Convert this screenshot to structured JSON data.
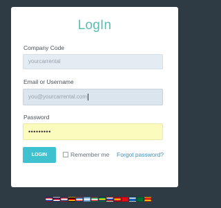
{
  "login": {
    "title": "LogIn",
    "company_code_label": "Company Code",
    "company_code_placeholder": "yourcarrental",
    "email_label": "Email or Username",
    "email_placeholder": "you@yourcarrental.com",
    "password_label": "Password",
    "password_value": "•••••••••",
    "login_button": "LOGIN",
    "remember_label": "Remember me",
    "forgot_link": "Forgot password?"
  },
  "languages": [
    {
      "icon": "flag-icon",
      "colors": [
        "#c8102e",
        "#ffffff",
        "#0033a0"
      ]
    },
    {
      "icon": "flag-icon",
      "colors": [
        "#012169",
        "#c8102e",
        "#ffffff"
      ]
    },
    {
      "icon": "flag-icon",
      "colors": [
        "#b22234",
        "#ffffff",
        "#3c3b6e"
      ]
    },
    {
      "icon": "flag-icon",
      "colors": [
        "#000000",
        "#dd0000",
        "#ffce00"
      ]
    },
    {
      "icon": "flag-icon",
      "colors": [
        "#0055a4",
        "#ffffff",
        "#ef4135"
      ]
    },
    {
      "icon": "flag-icon",
      "colors": [
        "#74acdf",
        "#ffffff",
        "#74acdf"
      ]
    },
    {
      "icon": "flag-icon",
      "colors": [
        "#009246",
        "#ffffff",
        "#ce2b37"
      ]
    },
    {
      "icon": "flag-icon",
      "colors": [
        "#009c3b",
        "#ffdf00",
        "#002776"
      ]
    },
    {
      "icon": "flag-icon",
      "colors": [
        "#ffffff",
        "#0039a6",
        "#d52b1e"
      ]
    },
    {
      "icon": "flag-icon",
      "colors": [
        "#c60b1e",
        "#ffc400",
        "#c60b1e"
      ]
    },
    {
      "icon": "flag-icon",
      "colors": [
        "#e30a17",
        "#e30a17",
        "#e30a17"
      ]
    },
    {
      "icon": "flag-icon",
      "colors": [
        "#ffffff",
        "#0d5eaf",
        "#0d5eaf"
      ]
    },
    {
      "icon": "flag-icon",
      "colors": [
        "#006c35",
        "#006c35",
        "#006c35"
      ]
    },
    {
      "icon": "flag-icon",
      "colors": [
        "#de2910",
        "#de2910",
        "#ffde00"
      ]
    }
  ]
}
